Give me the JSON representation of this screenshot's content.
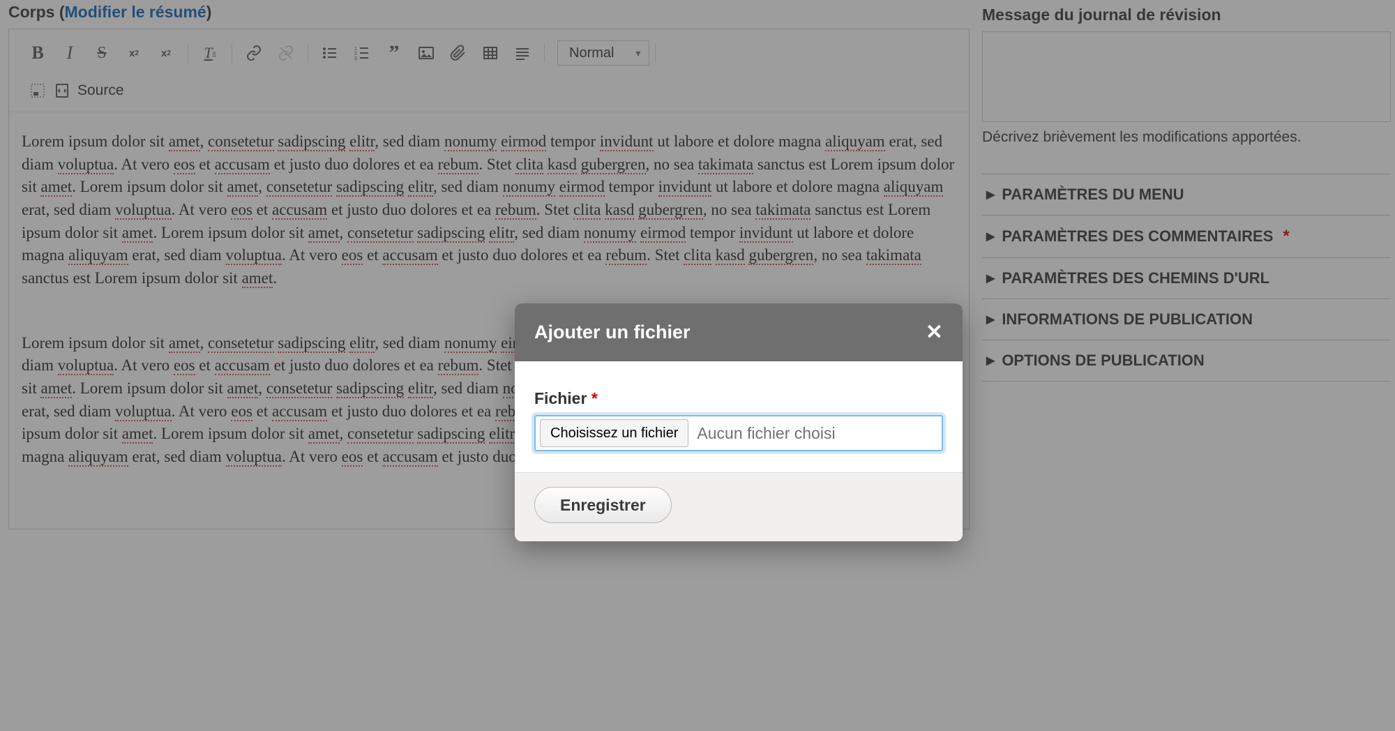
{
  "main": {
    "body_label_prefix": "Corps (",
    "body_label_link": "Modifier le résumé",
    "body_label_suffix": ")",
    "toolbar": {
      "format_select": "Normal",
      "source_label": "Source",
      "icons": {
        "bold": "B",
        "italic": "I",
        "strike": "S",
        "sup": "x",
        "sub": "x"
      }
    },
    "content_para1": "Lorem ipsum dolor sit amet, consetetur sadipscing elitr, sed diam nonumy eirmod tempor invidunt ut labore et dolore magna aliquyam erat, sed diam voluptua. At vero eos et accusam et justo duo dolores et ea rebum. Stet clita kasd gubergren, no sea takimata sanctus est Lorem ipsum dolor sit amet. Lorem ipsum dolor sit amet, consetetur sadipscing elitr, sed diam nonumy eirmod tempor invidunt ut labore et dolore magna aliquyam erat, sed diam voluptua. At vero eos et accusam et justo duo dolores et ea rebum. Stet clita kasd gubergren, no sea takimata sanctus est Lorem ipsum dolor sit amet. Lorem ipsum dolor sit amet, consetetur sadipscing elitr, sed diam nonumy eirmod tempor invidunt ut labore et dolore magna aliquyam erat, sed diam voluptua. At vero eos et accusam et justo duo dolores et ea rebum. Stet clita kasd gubergren, no sea takimata sanctus est Lorem ipsum dolor sit amet.",
    "content_para2": "Lorem ipsum dolor sit amet, consetetur sadipscing elitr, sed diam nonumy eirmod tempor invidunt ut labore et dolore magna aliquyam erat, sed diam voluptua. At vero eos et accusam et justo duo dolores et ea rebum. Stet clita kasd gubergren, no sea takimata sanctus est Lorem ipsum dolor sit amet. Lorem ipsum dolor sit amet, consetetur sadipscing elitr, sed diam nonumy eirmod tempor invidunt ut labore et dolore magna aliquyam erat, sed diam voluptua. At vero eos et accusam et justo duo dolores et ea rebum. Stet clita kasd gubergren, no sea takimata sanctus est Lorem ipsum dolor sit amet. Lorem ipsum dolor sit amet, consetetur sadipscing elitr, sed diam nonumy eirmod tempor invidunt ut labore et dolore magna aliquyam erat, sed diam voluptua. At vero eos et accusam et justo duo dolores"
  },
  "side": {
    "revision_label": "Message du journal de révision",
    "revision_help": "Décrivez brièvement les modifications apportées.",
    "accordion": [
      {
        "label": "PARAMÈTRES DU MENU",
        "required": false
      },
      {
        "label": "PARAMÈTRES DES COMMENTAIRES",
        "required": true
      },
      {
        "label": "PARAMÈTRES DES CHEMINS D'URL",
        "required": false
      },
      {
        "label": "INFORMATIONS DE PUBLICATION",
        "required": false
      },
      {
        "label": "OPTIONS DE PUBLICATION",
        "required": false
      }
    ]
  },
  "modal": {
    "title": "Ajouter un fichier",
    "file_label": "Fichier",
    "required_mark": "*",
    "choose_button": "Choisissez un fichier",
    "no_file": "Aucun fichier choisi",
    "save_button": "Enregistrer"
  }
}
